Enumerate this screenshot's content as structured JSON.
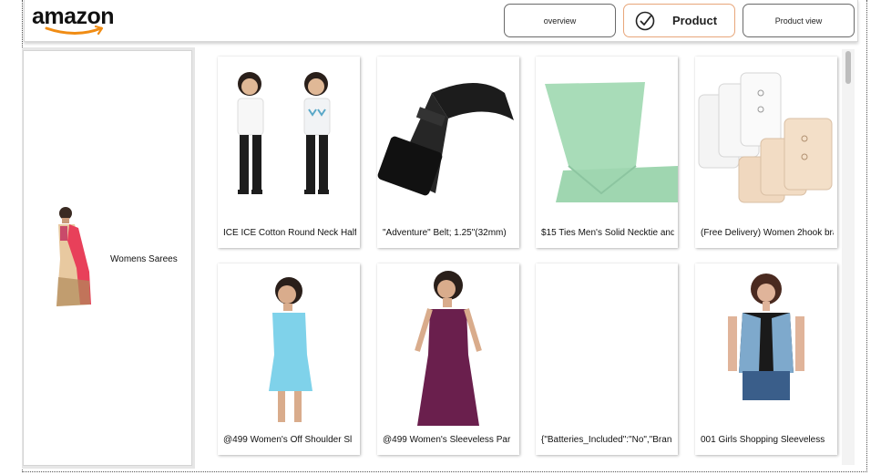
{
  "header": {
    "logo_text": "amazon",
    "nav": {
      "overview_label": "overview",
      "product_label": "Product",
      "productview_label": "Product view"
    }
  },
  "sidebar": {
    "items": [
      {
        "label": "Womens Sarees",
        "icon": "saree-product-image"
      }
    ]
  },
  "products": [
    {
      "title": "ICE ICE Cotton Round Neck Half",
      "icon": "girls-tshirt-image"
    },
    {
      "title": "\"Adventure\" Belt; 1.25\"(32mm)",
      "icon": "black-belt-image"
    },
    {
      "title": "$15 Ties Men's Solid Necktie and",
      "icon": "green-necktie-image"
    },
    {
      "title": "(Free Delivery) Women 2hook bra",
      "icon": "bra-extender-image"
    },
    {
      "title": "@499 Women's Off Shoulder Sl",
      "icon": "blue-dress-image"
    },
    {
      "title": "@499 Women's Sleeveless Par",
      "icon": "purple-dress-image"
    },
    {
      "title": "{\"Batteries_Included\":\"No\",\"Bran",
      "icon": "blank-image"
    },
    {
      "title": "001 Girls Shopping Sleeveless",
      "icon": "denim-vest-image"
    }
  ],
  "colors": {
    "accent_border": "#e8a67a",
    "logo_smile": "#f08c14"
  }
}
